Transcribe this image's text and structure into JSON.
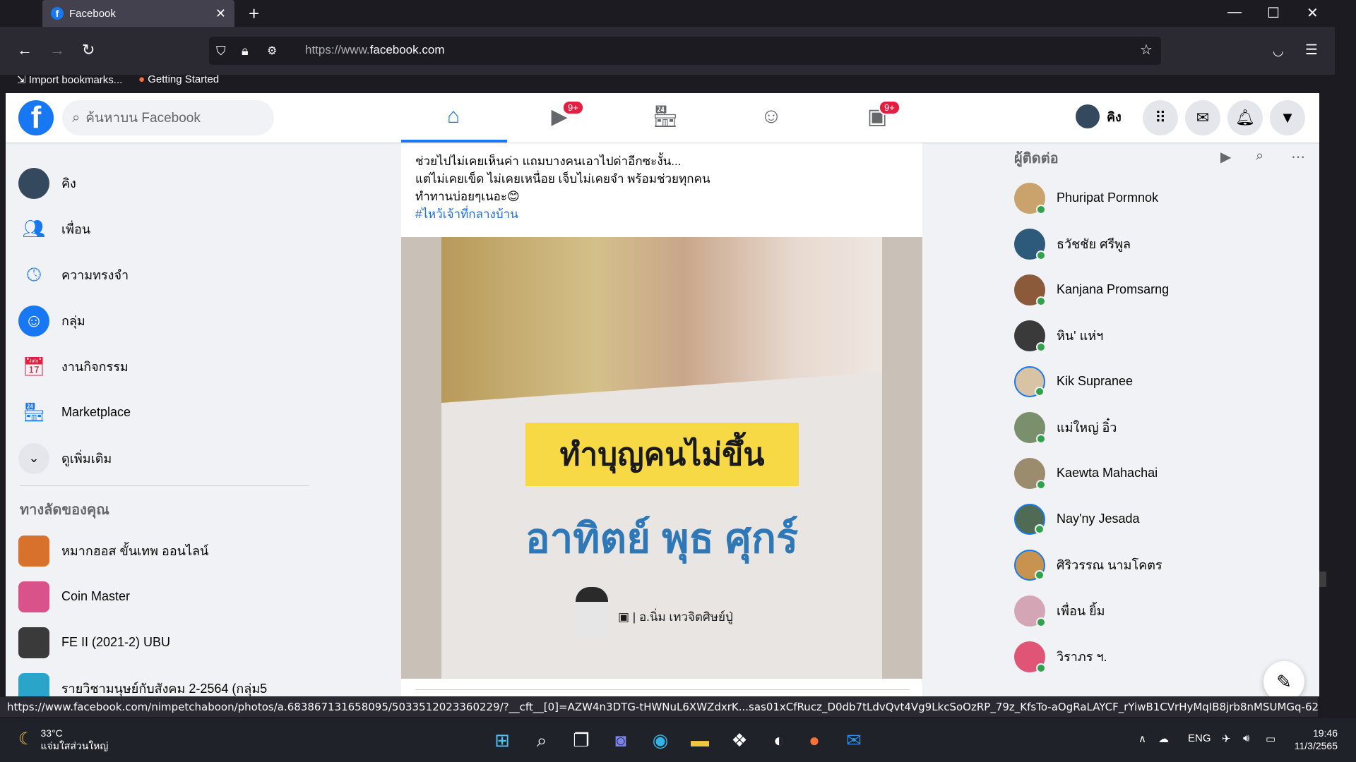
{
  "browser": {
    "tab_title": "Facebook",
    "url_prefix": "https://www.",
    "url_domain": "facebook.com",
    "bookmarks": [
      "Import bookmarks...",
      "Getting Started"
    ]
  },
  "fb": {
    "search_placeholder": "ค้นหาบน Facebook",
    "badge_watch": "9+",
    "badge_gaming": "9+",
    "profile_name": "คิง"
  },
  "left_nav": [
    {
      "label": "คิง",
      "icon": "avatar"
    },
    {
      "label": "เพื่อน",
      "icon": "friends-icon"
    },
    {
      "label": "ความทรงจำ",
      "icon": "memories-icon"
    },
    {
      "label": "กลุ่ม",
      "icon": "groups-icon"
    },
    {
      "label": "งานกิจกรรม",
      "icon": "events-icon"
    },
    {
      "label": "Marketplace",
      "icon": "marketplace-icon"
    },
    {
      "label": "ดูเพิ่มเติม",
      "icon": "chevron-down-icon"
    }
  ],
  "shortcuts_title": "ทางลัดของคุณ",
  "shortcuts": [
    {
      "label": "หมากฮอส ขั้นเทพ ออนไลน์",
      "color": "#d7712b"
    },
    {
      "label": "Coin Master",
      "color": "#d9528a"
    },
    {
      "label": "FE II (2021-2) UBU",
      "color": "#3a3a3a"
    },
    {
      "label": "รายวิชามนุษย์กับสังคม 2-2564 (กลุ่ม5",
      "color": "#2aa5c9"
    }
  ],
  "post": {
    "line1": "ช่วยไปไม่เคยเห็นค่า แถมบางคนเอาไปด่าอีกซะงั้น...",
    "line2": "แต่ไม่เคยเข็ด ไม่เคยเหนื่อย เจ็บไม่เคยจำ พร้อมช่วยทุกคน",
    "line3": "ทำทานบ่อยๆเนอะ😊",
    "hashtag": "#ไหว้เจ้าที่กลางบ้าน",
    "banner": "ทำบุญคนไม่ขึ้น",
    "days": "อาทิตย์ พุธ ศุกร์",
    "credit": "อ.นิ่ม เทวจิตศิษย์ปู่"
  },
  "contacts_title": "ผู้ติดต่อ",
  "contacts": [
    {
      "name": "Phuripat Pormnok",
      "color": "#c9a26c"
    },
    {
      "name": "ธวัชชัย ศรีพูล",
      "color": "#2d5a7b"
    },
    {
      "name": "Kanjana Promsarng",
      "color": "#8a5a3b"
    },
    {
      "name": "หิน' แห่ฯ",
      "color": "#3a3a3a"
    },
    {
      "name": "Kik Supranee",
      "color": "#d8c3a5"
    },
    {
      "name": "แม่ใหญ่ อิ๋ว",
      "color": "#7a8f6b"
    },
    {
      "name": "Kaewta Mahachai",
      "color": "#9c8c6e"
    },
    {
      "name": "Nay'ny Jesada",
      "color": "#4f6b54"
    },
    {
      "name": "ศิริวรรณ นามโคตร",
      "color": "#c7934e"
    },
    {
      "name": "เพื่อน ยิ้ม",
      "color": "#d4a6b5"
    },
    {
      "name": "วิราภร ฯ.",
      "color": "#e05475"
    }
  ],
  "status_url": "https://www.facebook.com/nimpetchaboon/photos/a.683867131658095/5033512023360229/?__cft__[0]=AZW4n3DTG-tHWNuL6XWZdxrK...sas01xCfRucz_D0db7tLdvQvt4Vg9LkcSoOzRP_79z_KfsTo-aOgRaLAYCF_rYiwB1CVrHyMqIB8jrb8nMSUMGq-62fAx7u4AfreHd59c&__tn__=EH-R",
  "taskbar": {
    "temp": "33°C",
    "weather": "แจ่มใสส่วนใหญ่",
    "lang": "ENG",
    "time": "19:46",
    "date": "11/3/2565"
  }
}
